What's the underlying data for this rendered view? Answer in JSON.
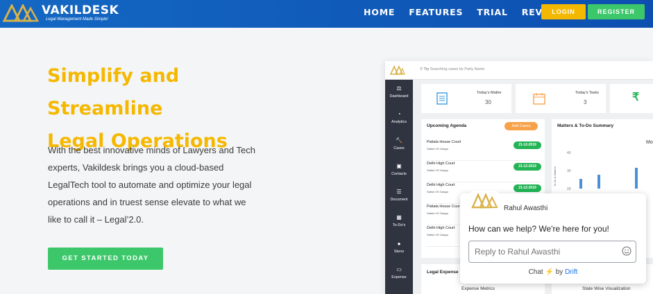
{
  "nav": {
    "brand": "VAKILDESK",
    "tagline": "Legal Management Made Simple!",
    "links": [
      "HOME",
      "FEATURES",
      "TRIAL",
      "REVIEWS"
    ],
    "login": "LOGIN",
    "register": "REGISTER"
  },
  "hero": {
    "title_line1": "Simplify and Streamline",
    "title_line2": "Legal Operations",
    "text": "With the best innovative minds of Lawyers and Tech experts, Vakildesk brings you a cloud-based LegalTech tool to automate and optimize your legal operations and in truest sense elevate to what we like to call it – Legal’2.0.",
    "cta": "GET STARTED TODAY"
  },
  "mockup": {
    "search_prefix": "Try",
    "search_placeholder": "Searching cases by Party Name",
    "sidebar": [
      "Dashboard",
      "Analytics",
      "Cases",
      "Contacts",
      "Document",
      "To-Do's",
      "Steno",
      "Expense"
    ],
    "stats": [
      {
        "label": "Today's Matter",
        "value": "30"
      },
      {
        "label": "Today's Tasks",
        "value": "3"
      }
    ],
    "agenda": {
      "title": "Upcoming Agenda",
      "add_button": "Add Cases",
      "rows": [
        {
          "court": "Patiala House Court",
          "party": "Satish VS Ganga",
          "date": "21-12-2019"
        },
        {
          "court": "Delhi High Court",
          "party": "Satish VS Ganga",
          "date": "21-12-2019"
        },
        {
          "court": "Delhi High Court",
          "party": "Satish VS Ganga",
          "date": "21-12-2019"
        },
        {
          "court": "Patiala House Court",
          "party": "Satish VS Ganga",
          "date": ""
        },
        {
          "court": "Delhi High Court",
          "party": "Satish VS Ganga",
          "date": ""
        }
      ]
    },
    "summary": {
      "title": "Matters & To-Do Summary",
      "corner_text": "Mo",
      "ylabel": "To-Do & Matters",
      "ticks": [
        "40",
        "30",
        "20"
      ]
    },
    "bottom": {
      "legal_expense": "Legal Expense",
      "expense_metrics": "Expense Metrics",
      "state_wise": "State Wise Visualization"
    },
    "colors": {
      "accent": "#f5b800",
      "green": "#22b455",
      "sidebar": "#2f3440"
    }
  },
  "chat": {
    "agent": "Rahul Awasthi",
    "message": "How can we help? We're here for you!",
    "placeholder": "Reply to Rahul Awasthi",
    "footer_chat": "Chat",
    "footer_by": "by",
    "footer_brand": "Drift"
  }
}
